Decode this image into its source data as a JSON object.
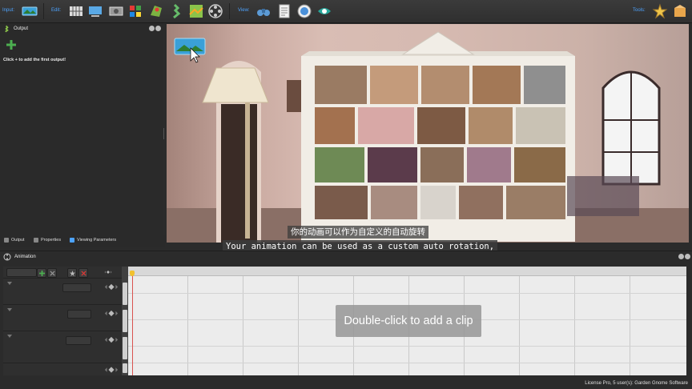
{
  "toolbar": {
    "input_label": "Input:",
    "edit_label": "Edit:",
    "view_label": "View:",
    "tools_label": "Tools:",
    "input_buttons": [
      "panorama-icon"
    ],
    "edit_buttons": [
      "grid-icon",
      "projection-icon",
      "image-icon",
      "crop-icon",
      "globe-icon",
      "straighten-icon",
      "map-icon",
      "film-reel-icon"
    ],
    "view_buttons": [
      "binoculars-icon",
      "notes-icon",
      "compass-icon",
      "eye-icon"
    ],
    "tools_buttons": [
      "star-tool-icon",
      "package-icon"
    ]
  },
  "output_panel": {
    "title": "Output",
    "hint": "Click + to add the first output!"
  },
  "left_tabs": [
    {
      "label": "Output",
      "icon": "output-icon"
    },
    {
      "label": "Properties",
      "icon": "properties-icon"
    },
    {
      "label": "Viewing Parameters",
      "icon": "viewing-params-icon"
    }
  ],
  "subtitles": {
    "chinese": "你的动画可以作为自定义的自动旋转",
    "english": "Your animation can be used as a custom auto rotation,"
  },
  "animation_panel": {
    "title": "Animation",
    "hint": "Double-click to add a clip"
  },
  "status": {
    "text": "License Pro, 5 user(s): Garden Gnome Software"
  },
  "colors": {
    "accent_blue": "#4da3ff",
    "playhead": "#d9534f",
    "playhead_marker": "#f2c12e",
    "add_green": "#4caf50"
  }
}
